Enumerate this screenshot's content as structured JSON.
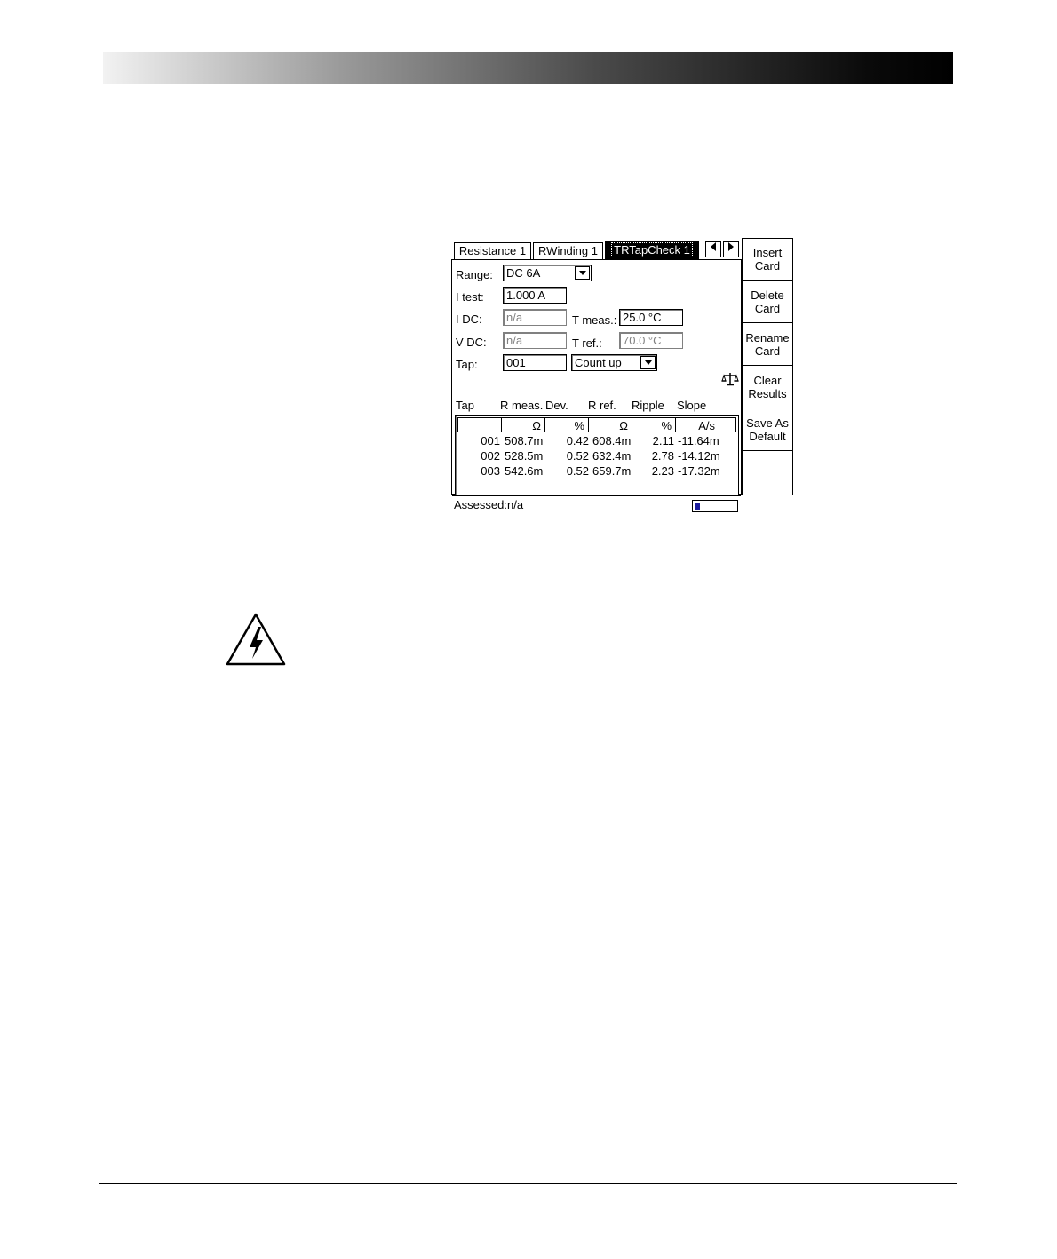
{
  "screen": {
    "tabs": [
      {
        "label": "Resistance 1",
        "active": false
      },
      {
        "label": "RWinding 1",
        "active": false
      },
      {
        "label": "TRTapCheck 1",
        "active": true
      }
    ],
    "nav": {
      "left_icon": "triangle-left-icon",
      "right_icon": "triangle-right-icon"
    },
    "fields": {
      "range": {
        "label": "Range:",
        "value": "DC 6A"
      },
      "i_test": {
        "label": "I test:",
        "value": "1.000 A"
      },
      "i_dc": {
        "label": "I DC:",
        "value": "n/a"
      },
      "v_dc": {
        "label": "V DC:",
        "value": "n/a"
      },
      "tap": {
        "label": "Tap:",
        "value": "001"
      },
      "t_meas": {
        "label": "T meas.:",
        "value": "25.0 °C"
      },
      "t_ref": {
        "label": "T ref.:",
        "value": "70.0 °C"
      },
      "tap_mode": {
        "value": "Count up"
      }
    },
    "table": {
      "headers": [
        "Tap",
        "R meas.",
        "Dev.",
        "R ref.",
        "Ripple",
        "Slope"
      ],
      "units": [
        "",
        "Ω",
        "%",
        "Ω",
        "%",
        "A/s"
      ],
      "rows": [
        [
          "001",
          "508.7m",
          "0.42",
          "608.4m",
          "2.11",
          "-11.64m"
        ],
        [
          "002",
          "528.5m",
          "0.52",
          "632.4m",
          "2.78",
          "-14.12m"
        ],
        [
          "003",
          "542.6m",
          "0.52",
          "659.7m",
          "2.23",
          "-17.32m"
        ]
      ]
    },
    "status": {
      "assessed": "Assessed:n/a",
      "progress_fraction": 0.12,
      "progress_color": "#1a1a9c"
    },
    "softkeys": [
      {
        "line1": "Insert",
        "line2": "Card"
      },
      {
        "line1": "Delete",
        "line2": "Card"
      },
      {
        "line1": "Rename",
        "line2": "Card"
      },
      {
        "line1": "Clear",
        "line2": "Results"
      },
      {
        "line1": "Save As",
        "line2": "Default"
      },
      {
        "line1": "",
        "line2": ""
      }
    ]
  },
  "icons": {
    "warning": "high-voltage-warning-icon",
    "assess": "scale-icon"
  }
}
